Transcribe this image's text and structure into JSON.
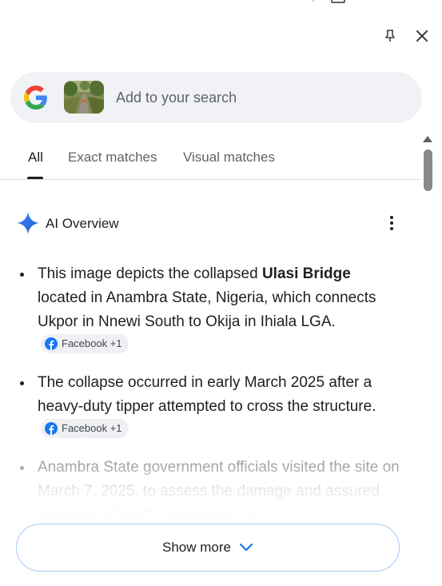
{
  "header": {
    "pin_icon": "pin-icon",
    "close_icon": "close-icon"
  },
  "search": {
    "placeholder": "Add to your search",
    "logo_icon": "google-g-icon",
    "thumbnail": "bridge-image-thumbnail"
  },
  "tabs": [
    {
      "label": "All",
      "active": true
    },
    {
      "label": "Exact matches",
      "active": false
    },
    {
      "label": "Visual matches",
      "active": false
    }
  ],
  "ai_overview": {
    "title": "AI Overview",
    "icon": "sparkle-icon",
    "menu_icon": "more-vert-icon",
    "bullets": [
      {
        "pre": "This image depicts the collapsed ",
        "bold": "Ulasi Bridge",
        "post": " located in Anambra State, Nigeria, which connects Ukpor in Nnewi South to Okija in Ihiala LGA.",
        "source": "Facebook +1"
      },
      {
        "text": "The collapse occurred in early March 2025 after a heavy-duty tipper attempted to cross the structure.",
        "source": "Facebook +1"
      },
      {
        "text": "Anambra State government officials visited the site on March 7, 2025, to assess the damage and assured residents of swift intervention for"
      }
    ]
  },
  "show_more": {
    "label": "Show more",
    "icon": "chevron-down-icon"
  },
  "colors": {
    "accent_blue": "#1a73e8",
    "pill_bg": "#f0f2f5",
    "button_border": "#a8c7fa",
    "facebook_blue": "#1877f2"
  }
}
